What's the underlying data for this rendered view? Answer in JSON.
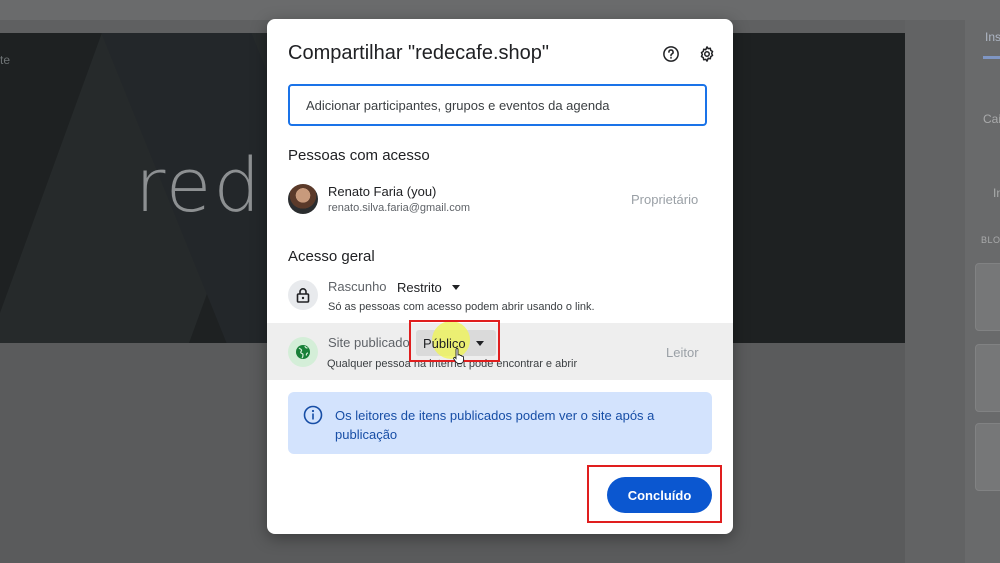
{
  "background": {
    "banner_text": "rede",
    "banner_small": "te",
    "right_panel": {
      "tab": "Ins",
      "item1": "Cai",
      "item2": "In",
      "section": "BLO"
    }
  },
  "dialog": {
    "title": "Compartilhar \"redecafe.shop\"",
    "help_icon": "help-circle-icon",
    "settings_icon": "gear-icon",
    "search_placeholder": "Adicionar participantes, grupos e eventos da agenda",
    "people_heading": "Pessoas com acesso",
    "person": {
      "name": "Renato Faria (you)",
      "email": "renato.silva.faria@gmail.com",
      "role": "Proprietário"
    },
    "general_heading": "Acesso geral",
    "draft": {
      "label": "Rascunho",
      "value": "Restrito",
      "description": "Só as pessoas com acesso podem abrir usando o link.",
      "icon": "lock-icon"
    },
    "published": {
      "label": "Site publicado",
      "value": "Público",
      "description": "Qualquer pessoa na internet pode encontrar e abrir",
      "role": "Leitor",
      "icon": "globe-icon"
    },
    "info_text": "Os leitores de itens publicados podem ver o site após a publicação",
    "done_label": "Concluído"
  },
  "colors": {
    "accent": "#0b57d0",
    "annotation": "#e01e1e",
    "info_bg": "#d3e3fd"
  }
}
